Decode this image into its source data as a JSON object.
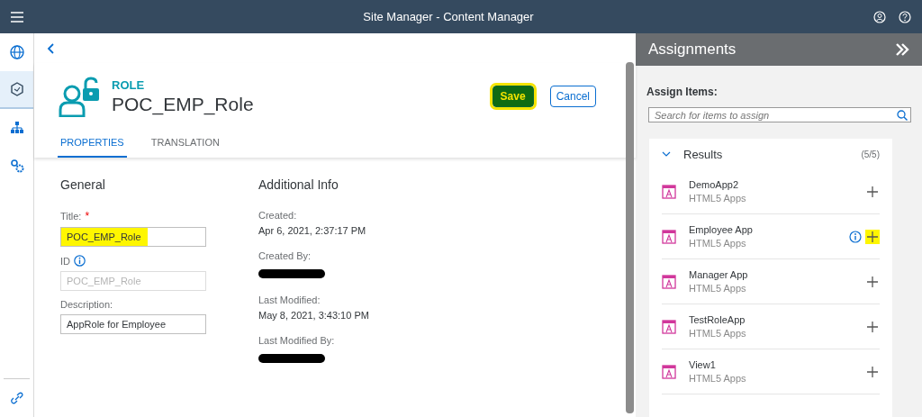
{
  "shell": {
    "title": "Site Manager - Content Manager"
  },
  "nav": [
    {
      "kind": "globe",
      "selected": false
    },
    {
      "kind": "cube",
      "selected": true
    },
    {
      "kind": "sitemap",
      "selected": false
    },
    {
      "kind": "gears",
      "selected": false
    }
  ],
  "header": {
    "type_label": "ROLE",
    "name": "POC_EMP_Role",
    "save": {
      "label": "Save",
      "highlighted": true
    },
    "cancel": "Cancel"
  },
  "tabs": [
    {
      "label": "PROPERTIES",
      "selected": true
    },
    {
      "label": "TRANSLATION",
      "selected": false
    }
  ],
  "general": {
    "heading": "General",
    "fields": [
      {
        "label": "Title:",
        "required_mark": "*",
        "info": false,
        "value": "POC_EMP_Role",
        "disabled": false,
        "highlighted": true
      },
      {
        "label": "ID",
        "info": true,
        "value": "POC_EMP_Role",
        "disabled": true,
        "highlighted": false
      },
      {
        "label": "Description:",
        "info": false,
        "value": "AppRole for Employee",
        "disabled": false,
        "highlighted": false
      }
    ]
  },
  "additional": {
    "heading": "Additional Info",
    "items": [
      {
        "label": "Created:",
        "value": "Apr 6, 2021, 2:37:17 PM",
        "redacted": false
      },
      {
        "label": "Created By:",
        "redacted": true
      },
      {
        "label": "Last Modified:",
        "value": "May 8, 2021, 3:43:10 PM",
        "redacted": false
      },
      {
        "label": "Last Modified By:",
        "redacted": true
      }
    ]
  },
  "assignments": {
    "title": "Assignments",
    "assign_label": "Assign Items:",
    "search": {
      "placeholder": "Search for items to assign"
    },
    "results": {
      "label": "Results",
      "count": "(5/5)",
      "expanded": true,
      "items": [
        {
          "name": "DemoApp2",
          "type": "HTML5 Apps",
          "info": false,
          "highlighted": false
        },
        {
          "name": "Employee App",
          "type": "HTML5 Apps",
          "info": true,
          "highlighted": true
        },
        {
          "name": "Manager App",
          "type": "HTML5 Apps",
          "info": false,
          "highlighted": false
        },
        {
          "name": "TestRoleApp",
          "type": "HTML5 Apps",
          "info": false,
          "highlighted": false
        },
        {
          "name": "View1",
          "type": "HTML5 Apps",
          "info": false,
          "highlighted": false
        }
      ]
    }
  }
}
